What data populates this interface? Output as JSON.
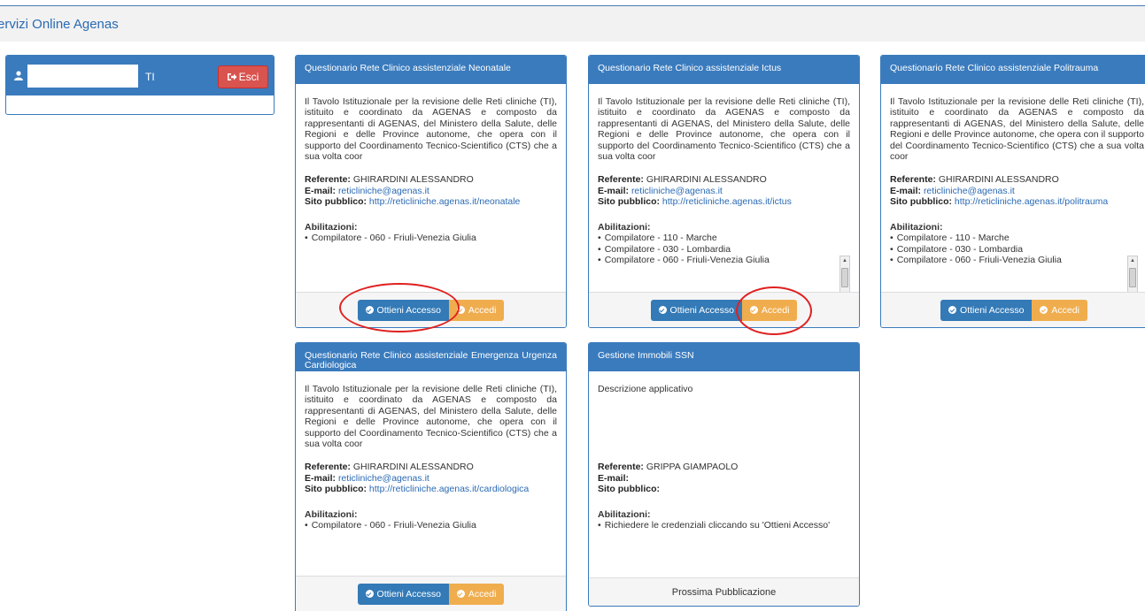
{
  "header": {
    "brand": "ervizi Online Agenas"
  },
  "user_panel": {
    "name_suffix": "TI",
    "logout_label": "Esci"
  },
  "cards": [
    {
      "title": "Questionario Rete Clinico assistenziale Neonatale",
      "description": "Il Tavolo Istituzionale per la revisione delle Reti cliniche (TI), istituito e coordinato da AGENAS e composto da rappresentanti di AGENAS, del Ministero della Salute, delle Regioni e delle Province autonome, che opera con il supporto del Coordinamento Tecnico-Scientifico (CTS) che a sua volta coor",
      "referente_label": "Referente:",
      "referente": "GHIRARDINI ALESSANDRO",
      "email_label": "E-mail:",
      "email": "reticliniche@agenas.it",
      "site_label": "Sito pubblico:",
      "site": "http://reticliniche.agenas.it/neonatale",
      "abil_label": "Abilitazioni:",
      "abilitazioni": [
        "Compilatore - 060 - Friuli-Venezia Giulia"
      ],
      "btn_access": "Ottieni Accesso",
      "btn_login": "Accedi"
    },
    {
      "title": "Questionario Rete Clinico assistenziale Ictus",
      "description": "Il Tavolo Istituzionale per la revisione delle Reti cliniche (TI), istituito e coordinato da AGENAS e composto da rappresentanti di AGENAS, del Ministero della Salute, delle Regioni e delle Province autonome, che opera con il supporto del Coordinamento Tecnico-Scientifico (CTS) che a sua volta coor",
      "referente_label": "Referente:",
      "referente": "GHIRARDINI ALESSANDRO",
      "email_label": "E-mail:",
      "email": "reticliniche@agenas.it",
      "site_label": "Sito pubblico:",
      "site": "http://reticliniche.agenas.it/ictus",
      "abil_label": "Abilitazioni:",
      "abilitazioni": [
        "Compilatore - 110 - Marche",
        "Compilatore - 030 - Lombardia",
        "Compilatore - 060 - Friuli-Venezia Giulia"
      ],
      "btn_access": "Ottieni Accesso",
      "btn_login": "Accedi"
    },
    {
      "title": "Questionario Rete Clinico assistenziale Politrauma",
      "description": "Il Tavolo Istituzionale per la revisione delle Reti cliniche (TI), istituito e coordinato da AGENAS e composto da rappresentanti di AGENAS, del Ministero della Salute, delle Regioni e delle Province autonome, che opera con il supporto del Coordinamento Tecnico-Scientifico (CTS) che a sua volta coor",
      "referente_label": "Referente:",
      "referente": "GHIRARDINI ALESSANDRO",
      "email_label": "E-mail:",
      "email": "reticliniche@agenas.it",
      "site_label": "Sito pubblico:",
      "site": "http://reticliniche.agenas.it/politrauma",
      "abil_label": "Abilitazioni:",
      "abilitazioni": [
        "Compilatore - 110 - Marche",
        "Compilatore - 030 - Lombardia",
        "Compilatore - 060 - Friuli-Venezia Giulia"
      ],
      "btn_access": "Ottieni Accesso",
      "btn_login": "Accedi"
    },
    {
      "title": "Questionario Rete Clinico assistenziale Emergenza Urgenza Cardiologica",
      "description": "Il Tavolo Istituzionale per la revisione delle Reti cliniche (TI), istituito e coordinato da AGENAS e composto da rappresentanti di AGENAS, del Ministero della Salute, delle Regioni e delle Province autonome, che opera con il supporto del Coordinamento Tecnico-Scientifico (CTS) che a sua volta coor",
      "referente_label": "Referente:",
      "referente": "GHIRARDINI ALESSANDRO",
      "email_label": "E-mail:",
      "email": "reticliniche@agenas.it",
      "site_label": "Sito pubblico:",
      "site": "http://reticliniche.agenas.it/cardiologica",
      "abil_label": "Abilitazioni:",
      "abilitazioni": [
        "Compilatore - 060 - Friuli-Venezia Giulia"
      ],
      "btn_access": "Ottieni Accesso",
      "btn_login": "Accedi"
    },
    {
      "title": "Gestione Immobili SSN",
      "description": "Descrizione applicativo",
      "referente_label": "Referente:",
      "referente": "GRIPPA GIAMPAOLO",
      "email_label": "E-mail:",
      "email": "",
      "site_label": "Sito pubblico:",
      "site": "",
      "abil_label": "Abilitazioni:",
      "abilitazioni": [
        "Richiedere le credenziali cliccando su 'Ottieni Accesso'"
      ],
      "footer_text": "Prossima Pubblicazione"
    }
  ],
  "colors": {
    "panel_blue": "#3a7bbd",
    "btn_blue": "#337ab7",
    "btn_orange": "#f0ad4e",
    "btn_red": "#d9534f",
    "annotation_red": "#e02020"
  }
}
